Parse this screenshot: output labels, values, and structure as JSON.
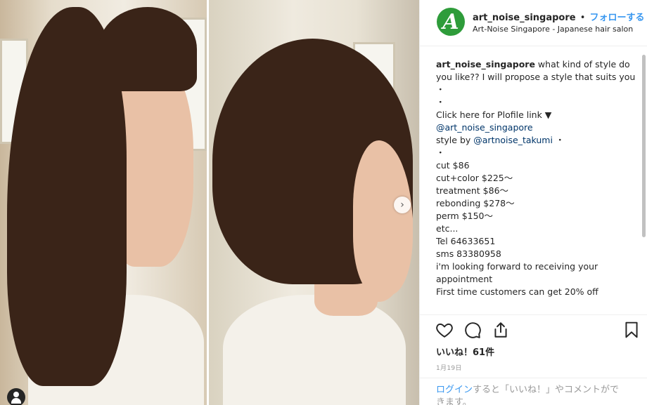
{
  "header": {
    "username": "art_noise_singapore",
    "separator": "•",
    "follow_label": "フォローする",
    "location": "Art-Noise Singapore - Japanese hair salon",
    "avatar_letter": "A"
  },
  "caption": {
    "username": "art_noise_singapore",
    "first_text": " what kind of style do you like?? I will propose a style that suits you",
    "bullet": "・",
    "profile_link_text": "Click here for Plofile link ▼",
    "mention_profile": "@art_noise_singapore",
    "style_by_label": "style by ",
    "mention_stylist": "@artnoise_takumi",
    "lines": [
      "cut $86",
      "cut+color $225〜",
      "treatment $86〜",
      "rebonding $278〜",
      "perm $150〜",
      "etc...",
      "Tel 64633651",
      "sms 83380958",
      "i'm looking forward to receiving your appointment",
      "First time customers can get 20% off"
    ]
  },
  "likes_label": "いいね！61件",
  "date_label": "1月19日",
  "login": {
    "link": "ログイン",
    "text": "すると「いいね！」やコメントができます。"
  },
  "photo": {
    "next_arrow": "›"
  },
  "colors": {
    "accent_blue": "#3897f0",
    "avatar_green": "#2e9c3a",
    "mention": "#003569"
  },
  "icons": [
    "heart-icon",
    "comment-icon",
    "share-icon",
    "bookmark-icon",
    "chevron-right-icon",
    "user-tag-icon"
  ]
}
